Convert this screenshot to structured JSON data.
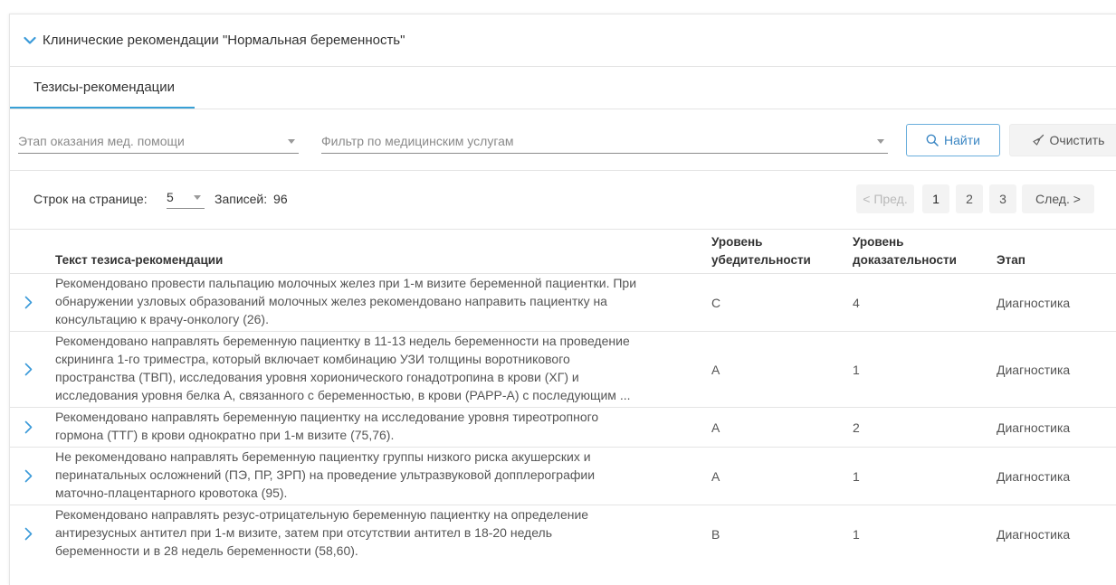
{
  "panel": {
    "title": "Клинические рекомендации \"Нормальная беременность\""
  },
  "tabs": [
    {
      "label": "Тезисы-рекомендации"
    }
  ],
  "filters": {
    "stage_placeholder": "Этап оказания мед. помощи",
    "services_placeholder": "Фильтр по медицинским услугам",
    "find_label": "Найти",
    "clear_label": "Очистить"
  },
  "pager": {
    "rows_label": "Строк на странице:",
    "rows_value": "5",
    "records_label": "Записей:",
    "records_value": "96",
    "prev_label": "< Пред.",
    "pages": [
      "1",
      "2",
      "3"
    ],
    "current_page": "1",
    "next_label": "След. >"
  },
  "table": {
    "columns": {
      "text": "Текст тезиса-рекомендации",
      "conviction_1": "Уровень",
      "conviction_2": "убедительности",
      "evidence_1": "Уровень",
      "evidence_2": "доказательности",
      "stage": "Этап"
    },
    "rows": [
      {
        "lines": [
          "Рекомендовано провести пальпацию молочных желез при 1-м визите беременной пациентки. При",
          "обнаружении узловых образований молочных желез рекомендовано направить пациентку на",
          "консультацию к врачу-онкологу (26)."
        ],
        "conviction": "C",
        "evidence": "4",
        "stage": "Диагностика"
      },
      {
        "lines": [
          "Рекомендовано направлять беременную пациентку в 11-13 недель беременности на проведение",
          "скрининга 1-го триместра, который включает комбинацию УЗИ толщины воротникового",
          "пространства (ТВП), исследования уровня хорионического гонадотропина в крови (ХГ) и",
          "исследования уровня белка А, связанного с беременностью, в крови (PAPP-A) с последующим ..."
        ],
        "conviction": "A",
        "evidence": "1",
        "stage": "Диагностика"
      },
      {
        "lines": [
          "Рекомендовано направлять беременную пациентку на исследование уровня тиреотропного",
          "гормона (ТТГ) в крови однократно при 1-м визите (75,76)."
        ],
        "conviction": "A",
        "evidence": "2",
        "stage": "Диагностика"
      },
      {
        "lines": [
          "Не рекомендовано направлять беременную пациентку группы низкого риска акушерских и",
          "перинатальных осложнений (ПЭ, ПР, ЗРП) на проведение ультразвуковой допплерографии",
          "маточно-плацентарного кровотока (95)."
        ],
        "conviction": "A",
        "evidence": "1",
        "stage": "Диагностика"
      },
      {
        "lines": [
          "Рекомендовано направлять резус-отрицательную беременную пациентку на определение",
          "антирезусных антител при 1-м визите, затем при отсутствии антител в 18-20 недель",
          "беременности и в 28 недель беременности (58,60)."
        ],
        "conviction": "B",
        "evidence": "1",
        "stage": "Диагностика"
      }
    ]
  }
}
